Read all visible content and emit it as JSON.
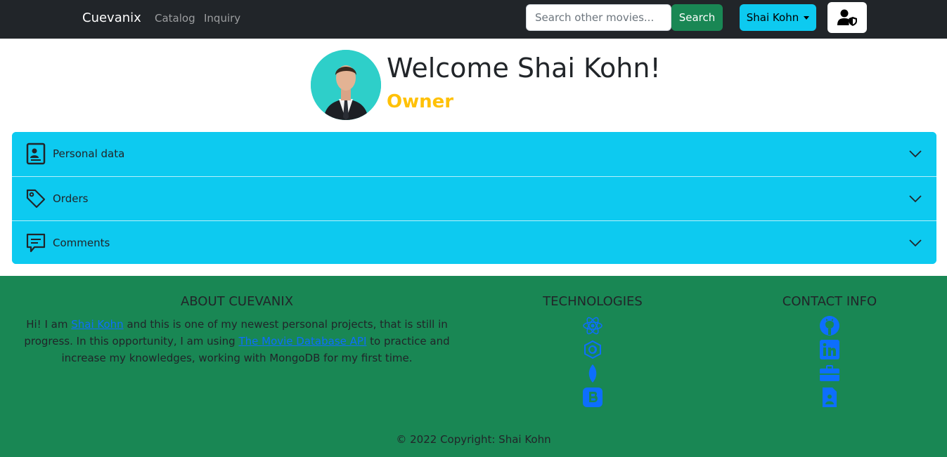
{
  "navbar": {
    "brand": "Cuevanix",
    "links": [
      "Catalog",
      "Inquiry"
    ],
    "search_placeholder": "Search other movies...",
    "search_label": "Search",
    "user_label": "Shai Kohn",
    "admin_icon": "user-shield-icon"
  },
  "profile": {
    "welcome": "Welcome Shai Kohn!",
    "role": "Owner"
  },
  "accordion": [
    {
      "label": "Personal data",
      "icon": "person-vcard-icon"
    },
    {
      "label": "Orders",
      "icon": "tag-icon"
    },
    {
      "label": "Comments",
      "icon": "chat-left-text-icon"
    }
  ],
  "footer": {
    "about_title": "ABOUT CUEVANIX",
    "about_pre": "Hi! I am ",
    "about_link1": "Shai Kohn",
    "about_mid": " and this is one of my newest personal projects, that is still in progress. In this opportunity, I am using ",
    "about_link2": "The Movie Database API",
    "about_post": " to practice and increase my knowledges, working with MongoDB for my first time.",
    "tech_title": "TECHNOLOGIES",
    "tech_icons": [
      "react-icon",
      "redux-icon",
      "mongodb-icon",
      "bootstrap-icon"
    ],
    "contact_title": "CONTACT INFO",
    "contact_icons": [
      "github-icon",
      "linkedin-icon",
      "briefcase-icon",
      "file-person-icon"
    ],
    "copyright": "© 2022 Copyright: Shai Kohn"
  },
  "colors": {
    "navbar": "#212529",
    "accent_info": "#0dcaf0",
    "success": "#198754",
    "warning": "#ffc107",
    "link": "#0d6efd"
  }
}
